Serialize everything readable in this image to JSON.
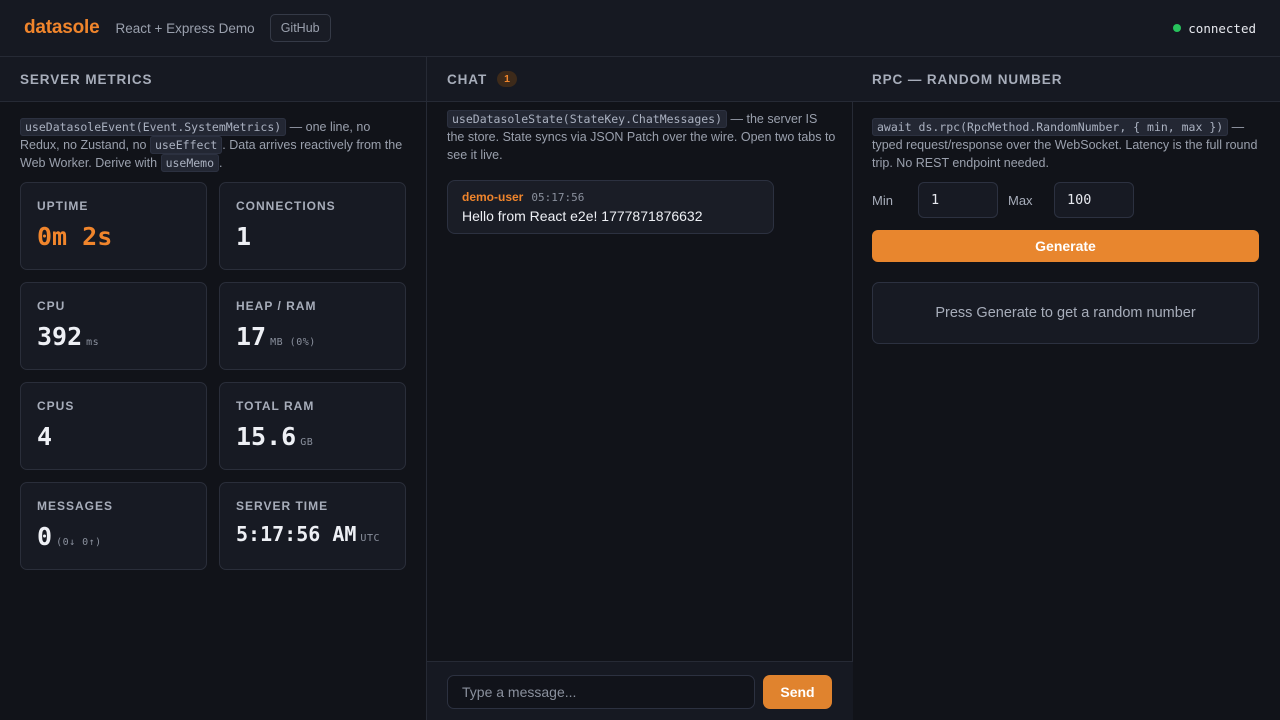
{
  "header": {
    "logo": "datasole",
    "subtitle": "React + Express Demo",
    "github_label": "GitHub",
    "status_label": "connected",
    "status_color": "#27c25c"
  },
  "metrics": {
    "title": "SERVER METRICS",
    "desc_code_1": "useDatasoleEvent(Event.SystemMetrics)",
    "desc_text_1": " — one line, no Redux, no Zustand, no ",
    "desc_code_2": "useEffect",
    "desc_text_2": ". Data arrives reactively from the Web Worker. Derive with ",
    "desc_code_3": "useMemo",
    "desc_text_3": ".",
    "cards": [
      {
        "label": "UPTIME",
        "value": "0m 2s",
        "unit": ""
      },
      {
        "label": "CONNECTIONS",
        "value": "1",
        "unit": ""
      },
      {
        "label": "CPU",
        "value": "392",
        "unit": "ms"
      },
      {
        "label": "HEAP / RAM",
        "value": "17",
        "unit": "MB (0%)"
      },
      {
        "label": "CPUS",
        "value": "4",
        "unit": ""
      },
      {
        "label": "TOTAL RAM",
        "value": "15.6",
        "unit": "GB"
      },
      {
        "label": "MESSAGES",
        "value": "0",
        "unit": "(0↓ 0↑)"
      },
      {
        "label": "SERVER TIME",
        "value": "5:17:56 AM",
        "unit": "UTC"
      }
    ]
  },
  "chat": {
    "title": "CHAT",
    "badge": "1",
    "desc_code": "useDatasoleState(StateKey.ChatMessages)",
    "desc_text": " — the server IS the store. State syncs via JSON Patch over the wire. Open two tabs to see it live.",
    "messages": [
      {
        "user": "demo-user",
        "time": "05:17:56",
        "text": "Hello from React e2e! 1777871876632"
      }
    ],
    "input_placeholder": "Type a message...",
    "input_value": "",
    "send_label": "Send"
  },
  "rpc": {
    "title": "RPC — RANDOM NUMBER",
    "desc_code": "await ds.rpc(RpcMethod.RandomNumber, { min, max })",
    "desc_text": " — typed request/response over the WebSocket. Latency is the full round trip. No REST endpoint needed.",
    "min_label": "Min",
    "min_value": "1",
    "max_label": "Max",
    "max_value": "100",
    "generate_label": "Generate",
    "result_text": "Press Generate to get a random number"
  },
  "colors": {
    "accent": "#f0852c",
    "background": "#111319",
    "panel": "#161922"
  }
}
